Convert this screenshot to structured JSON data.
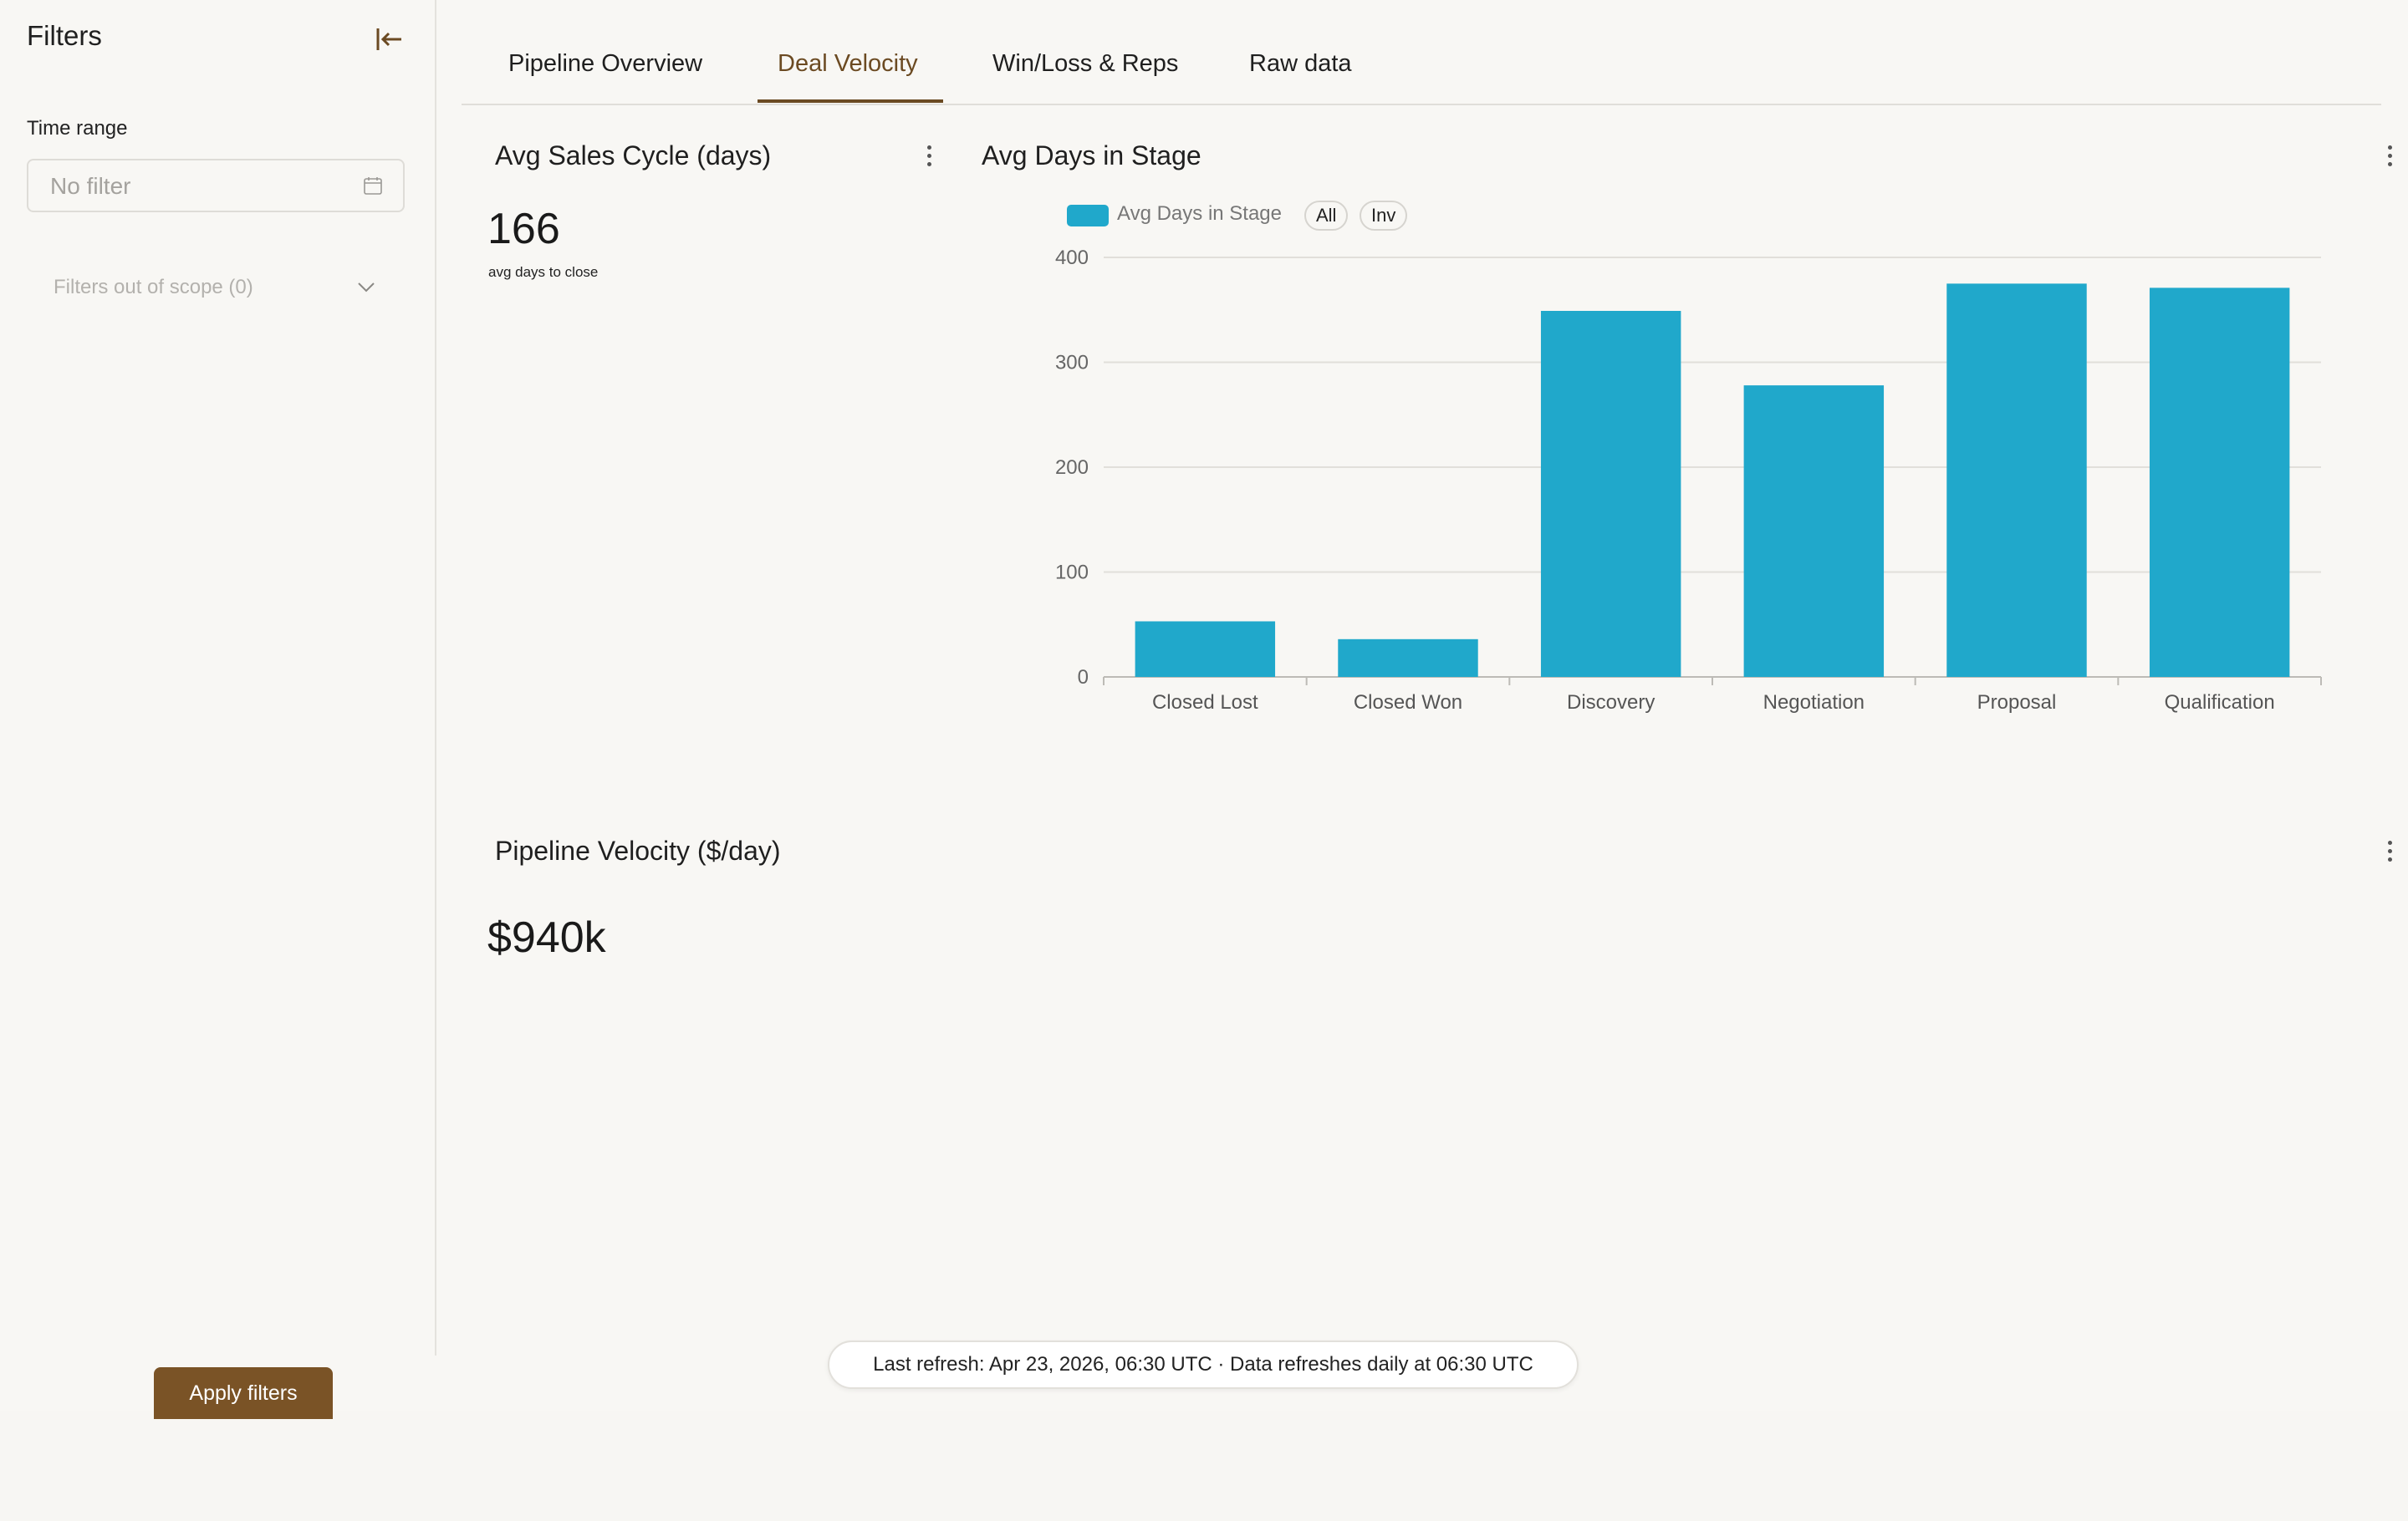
{
  "sidebar": {
    "title": "Filters",
    "time_range_label": "Time range",
    "time_range_placeholder": "No filter",
    "out_of_scope_label": "Filters out of scope (0)",
    "apply_label": "Apply filters"
  },
  "tabs": [
    {
      "label": "Pipeline Overview"
    },
    {
      "label": "Deal Velocity",
      "active": true
    },
    {
      "label": "Win/Loss & Reps"
    },
    {
      "label": "Raw data"
    }
  ],
  "cards": {
    "sales_cycle": {
      "title": "Avg Sales Cycle (days)",
      "value": "166",
      "subtitle": "avg days to close"
    },
    "days_in_stage": {
      "title": "Avg Days in Stage",
      "legend_label": "Avg Days in Stage",
      "pill_all": "All",
      "pill_inv": "Inv"
    },
    "pipeline_velocity": {
      "title": "Pipeline Velocity ($/day)",
      "value": "$940k"
    }
  },
  "chart_data": {
    "type": "bar",
    "title": "Avg Days in Stage",
    "categories": [
      "Closed Lost",
      "Closed Won",
      "Discovery",
      "Negotiation",
      "Proposal",
      "Qualification"
    ],
    "series": [
      {
        "name": "Avg Days in Stage",
        "values": [
          53,
          36,
          349,
          278,
          375,
          371
        ]
      }
    ],
    "ylim": [
      0,
      400
    ],
    "yticks": [
      0,
      100,
      200,
      300,
      400
    ],
    "grid": true,
    "legend": "top-left",
    "color": "#20a8cb"
  },
  "footer": {
    "refresh_text": "Last refresh: Apr 23, 2026, 06:30 UTC · Data refreshes daily at 06:30 UTC"
  },
  "colors": {
    "accent": "#6b4a22",
    "button": "#7a5326",
    "bar": "#20a8cb",
    "background": "#f8f7f4"
  }
}
